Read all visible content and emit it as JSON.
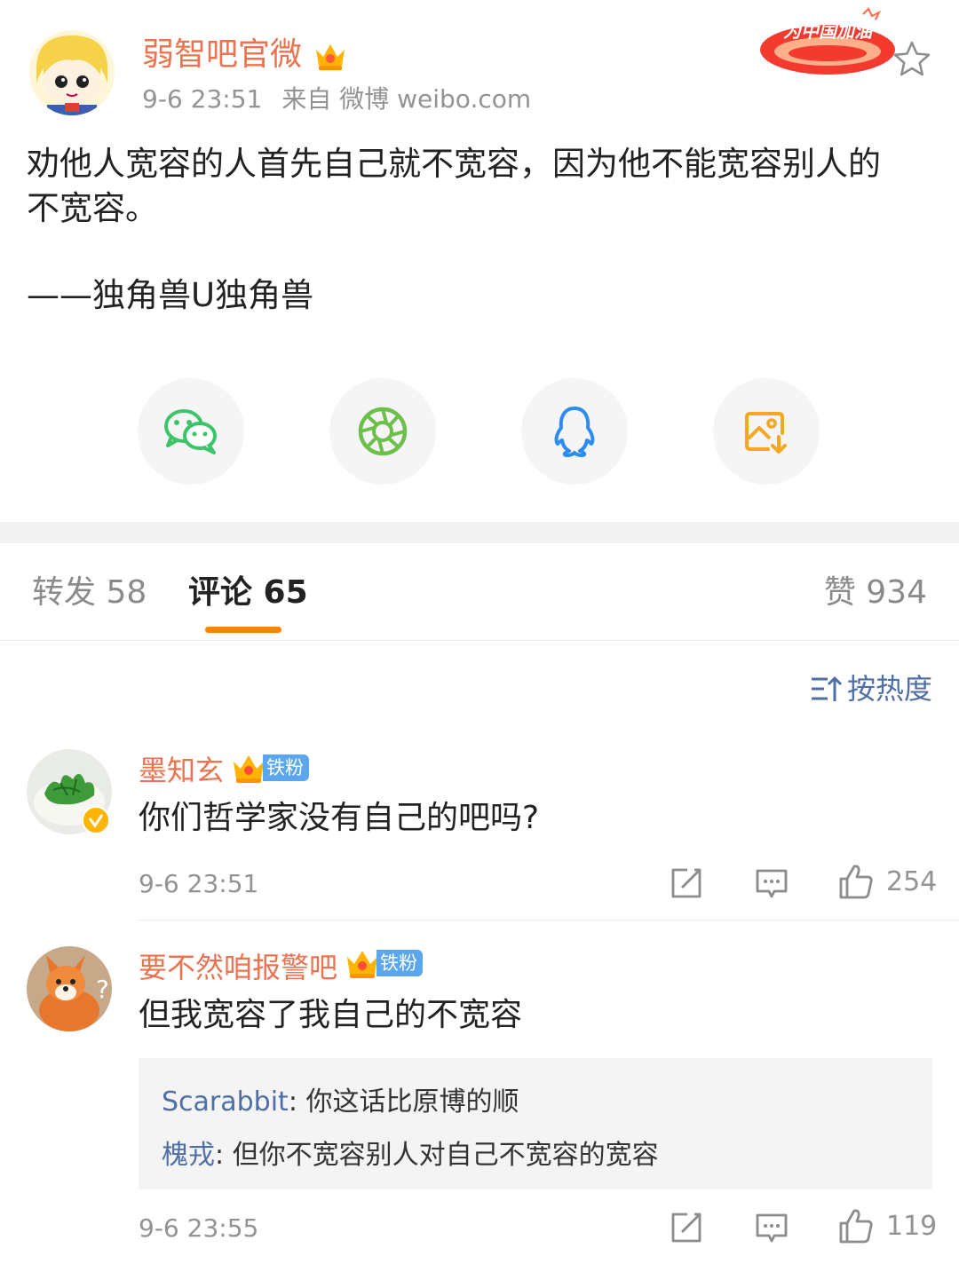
{
  "post": {
    "username": "弱智吧官微",
    "time": "9-6 23:51",
    "source": "来自 微博 weibo.com",
    "badge_text": "为中国加油",
    "content_line1": "劝他人宽容的人首先自己就不宽容，因为他不能宽容别人的",
    "content_line2": "不宽容。",
    "signature": "——独角兽U独角兽"
  },
  "share": {
    "items": [
      "wechat-icon",
      "moments-icon",
      "qq-icon",
      "save-image-icon"
    ]
  },
  "colors": {
    "username": "#eb7350",
    "tab_accent": "#ff8200",
    "link_blue": "#4e6ea5",
    "wechat_green": "#3cc46a",
    "qq_blue": "#2d8cf0",
    "save_orange": "#f5a623"
  },
  "tabs": {
    "repost": "转发 58",
    "comment": "评论 65",
    "like": "赞 934"
  },
  "sort": {
    "label": "按热度"
  },
  "comments": [
    {
      "name": "墨知玄",
      "badge": "铁粉",
      "text": "你们哲学家没有自己的吧吗?",
      "time": "9-6 23:51",
      "likes": "254"
    },
    {
      "name": "要不然咱报警吧",
      "badge": "铁粉",
      "text": "但我宽容了我自己的不宽容",
      "time": "9-6 23:55",
      "likes": "119",
      "replies": [
        {
          "name": "Scarabbit",
          "text": ": 你这话比原博的顺"
        },
        {
          "name": "槐戎",
          "text": ": 但你不宽容别人对自己不宽容的宽容"
        }
      ]
    }
  ]
}
